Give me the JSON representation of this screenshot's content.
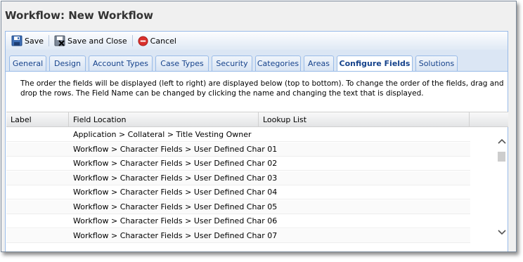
{
  "window": {
    "title": "Workflow: New Workflow"
  },
  "toolbar": {
    "save_label": "Save",
    "save_close_label": "Save and Close",
    "cancel_label": "Cancel"
  },
  "tabs": [
    {
      "label": "General"
    },
    {
      "label": "Design"
    },
    {
      "label": "Account Types"
    },
    {
      "label": "Case Types"
    },
    {
      "label": "Security"
    },
    {
      "label": "Categories"
    },
    {
      "label": "Areas"
    },
    {
      "label": "Configure Fields",
      "active": true
    },
    {
      "label": "Solutions"
    }
  ],
  "description": "The order the fields will be displayed (left to right) are displayed below (top to bottom). To change the order of the fields, drag and drop the rows. The Field Name can be changed by clicking the name and changing the text that is displayed.",
  "grid": {
    "columns": [
      "Label",
      "Field Location",
      "Lookup List"
    ],
    "rows": [
      {
        "label": "",
        "location": "Application > Collateral > Title Vesting Owner",
        "lookup": ""
      },
      {
        "label": "",
        "location": "Workflow > Character Fields > User Defined Char 01",
        "lookup": ""
      },
      {
        "label": "",
        "location": "Workflow > Character Fields > User Defined Char 02",
        "lookup": ""
      },
      {
        "label": "",
        "location": "Workflow > Character Fields > User Defined Char 03",
        "lookup": ""
      },
      {
        "label": "",
        "location": "Workflow > Character Fields > User Defined Char 04",
        "lookup": ""
      },
      {
        "label": "",
        "location": "Workflow > Character Fields > User Defined Char 05",
        "lookup": ""
      },
      {
        "label": "",
        "location": "Workflow > Character Fields > User Defined Char 06",
        "lookup": ""
      },
      {
        "label": "",
        "location": "Workflow > Character Fields > User Defined Char 07",
        "lookup": ""
      }
    ]
  },
  "icons": {
    "save": "floppy-disk-icon",
    "save_close": "floppy-disk-close-icon",
    "cancel": "cancel-circle-icon",
    "scroll_up": "chevron-up-icon",
    "scroll_down": "chevron-down-icon"
  },
  "colors": {
    "accent": "#15428b",
    "border": "#99bbe8",
    "cancel": "#d9302c"
  }
}
